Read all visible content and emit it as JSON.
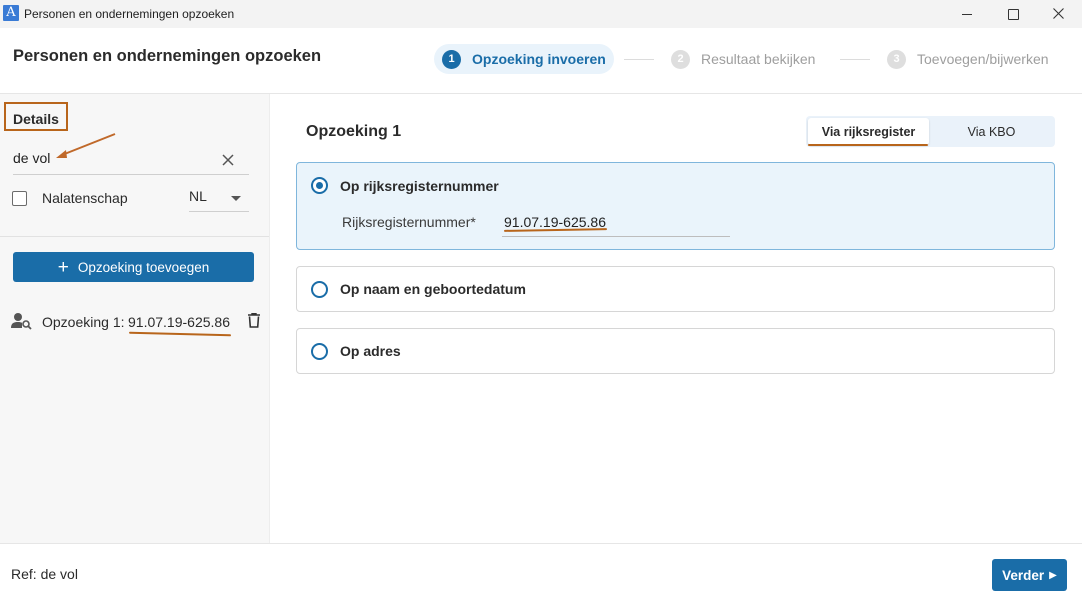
{
  "window": {
    "icon_glyph": "A",
    "title": "Personen en ondernemingen opzoeken"
  },
  "header": {
    "title": "Personen en ondernemingen opzoeken",
    "steps": [
      {
        "num": "1",
        "label": "Opzoeking invoeren",
        "active": true
      },
      {
        "num": "2",
        "label": "Resultaat bekijken",
        "active": false
      },
      {
        "num": "3",
        "label": "Toevoegen/bijwerken",
        "active": false
      }
    ]
  },
  "sidebar": {
    "details_label": "Details",
    "ref_input_value": "de vol",
    "nalatenschap_label": "Nalatenschap",
    "nalatenschap_checked": false,
    "language_value": "NL",
    "add_button_label": "Opzoeking toevoegen",
    "searches": [
      {
        "label": "Opzoeking 1:",
        "value": "91.07.19-625.86"
      }
    ]
  },
  "main": {
    "section_title": "Opzoeking 1",
    "tabs": [
      {
        "label": "Via rijksregister",
        "active": true
      },
      {
        "label": "Via KBO",
        "active": false
      }
    ],
    "options": [
      {
        "label": "Op rijksregisternummer",
        "selected": true
      },
      {
        "label": "Op naam en geboortedatum",
        "selected": false
      },
      {
        "label": "Op adres",
        "selected": false
      }
    ],
    "rijksregister_label": "Rijksregisternummer*",
    "rijksregister_value": "91.07.19-625.86"
  },
  "footer": {
    "ref_text": "Ref: de vol",
    "next_label": "Verder",
    "next_arrow": "▶"
  },
  "colors": {
    "accent": "#1a6da8",
    "annotation": "#b8651b",
    "selected_bg": "#eaf4fb"
  }
}
